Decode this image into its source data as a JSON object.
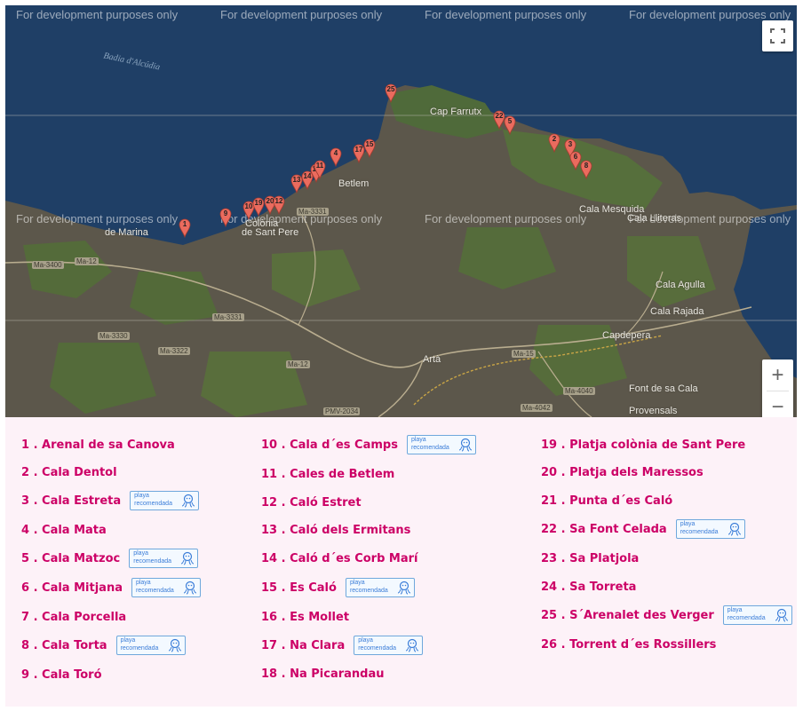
{
  "map": {
    "watermark_text": "For development purposes only",
    "sea_label": "Badia d'Alcúdia",
    "place_labels": [
      "Cap Farrutx",
      "Betlem",
      "Cala Mesquida",
      "Colònia",
      "de Sant Pere",
      "de Marina",
      "Cala Agulla",
      "Cala Rajada",
      "Capdepera",
      "Artà",
      "Font de sa Cala",
      "Provensals",
      "Cala Lliteras"
    ],
    "road_labels": [
      "Ma-3400",
      "Ma-12",
      "Ma-3331",
      "Ma-3330",
      "Ma-3322",
      "Ma-12",
      "Ma-15",
      "Ma-4040",
      "Ma-4042",
      "PMV-2034",
      "Ma-3331"
    ],
    "markers": [
      "1",
      "9",
      "10",
      "19",
      "20",
      "12",
      "13",
      "14",
      "18",
      "11",
      "4",
      "17",
      "15",
      "25",
      "22",
      "5",
      "2",
      "3",
      "6",
      "8"
    ],
    "controls": {
      "fullscreen": "fullscreen-icon",
      "zoom_in": "+",
      "zoom_out": "−"
    }
  },
  "badge": {
    "line1": "playa",
    "line2": "recomendada"
  },
  "beaches": {
    "col1": [
      {
        "label": "1 . Arenal de sa Canova",
        "recommended": false
      },
      {
        "label": "2 . Cala Dentol",
        "recommended": false
      },
      {
        "label": "3 . Cala Estreta",
        "recommended": true
      },
      {
        "label": "4 . Cala Mata",
        "recommended": false
      },
      {
        "label": "5 . Cala Matzoc",
        "recommended": true
      },
      {
        "label": "6 . Cala Mitjana",
        "recommended": true
      },
      {
        "label": "7 . Cala Porcella",
        "recommended": false
      },
      {
        "label": "8 . Cala Torta",
        "recommended": true
      },
      {
        "label": "9 . Cala Toró",
        "recommended": false
      }
    ],
    "col2": [
      {
        "label": "10 . Cala d´es Camps",
        "recommended": true
      },
      {
        "label": "11 . Cales de Betlem",
        "recommended": false
      },
      {
        "label": "12 . Caló Estret",
        "recommended": false
      },
      {
        "label": "13 . Caló dels Ermitans",
        "recommended": false
      },
      {
        "label": "14 . Caló d´es Corb Marí",
        "recommended": false
      },
      {
        "label": "15 . Es Caló",
        "recommended": true
      },
      {
        "label": "16 . Es Mollet",
        "recommended": false
      },
      {
        "label": "17 . Na Clara",
        "recommended": true
      },
      {
        "label": "18 . Na Picarandau",
        "recommended": false
      }
    ],
    "col3": [
      {
        "label": "19 . Platja colònia de Sant Pere",
        "recommended": false
      },
      {
        "label": "20 . Platja dels Maressos",
        "recommended": false
      },
      {
        "label": "21 . Punta d´es Caló",
        "recommended": false
      },
      {
        "label": "22 . Sa Font Celada",
        "recommended": true
      },
      {
        "label": "23 . Sa Platjola",
        "recommended": false
      },
      {
        "label": "24 . Sa Torreta",
        "recommended": false
      },
      {
        "label": "25 . S´Arenalet des Verger",
        "recommended": true
      },
      {
        "label": "26 . Torrent d´es Rossillers",
        "recommended": false
      }
    ]
  },
  "colors": {
    "link": "#cc0066",
    "list_bg": "#fdf2f8",
    "sea": "#1f3f66",
    "land": "#5f5a4d",
    "forest": "#556b3a",
    "marker": "#ea6b5e"
  }
}
